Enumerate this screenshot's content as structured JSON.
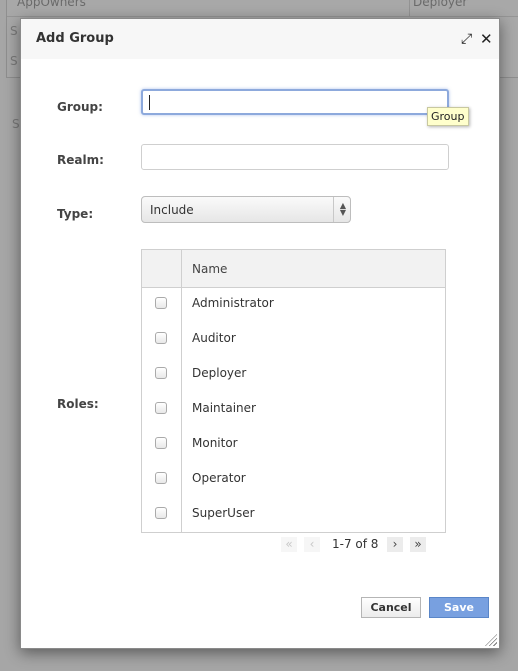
{
  "background": {
    "table_row": [
      "AppOwners",
      "Deployer"
    ],
    "stub_letters": [
      "S",
      "S",
      "S"
    ]
  },
  "dialog": {
    "title": "Add Group",
    "expand_icon": "expand-arrows-icon",
    "close_icon": "close-icon",
    "fields": {
      "group": {
        "label": "Group:",
        "value": "",
        "tooltip": "Group"
      },
      "realm": {
        "label": "Realm:",
        "value": ""
      },
      "type": {
        "label": "Type:",
        "selected": "Include"
      },
      "roles": {
        "label": "Roles:"
      }
    },
    "roles_table": {
      "header": "Name",
      "rows": [
        {
          "name": "Administrator",
          "checked": false
        },
        {
          "name": "Auditor",
          "checked": false
        },
        {
          "name": "Deployer",
          "checked": false
        },
        {
          "name": "Maintainer",
          "checked": false
        },
        {
          "name": "Monitor",
          "checked": false
        },
        {
          "name": "Operator",
          "checked": false
        },
        {
          "name": "SuperUser",
          "checked": false
        }
      ]
    },
    "pagination": {
      "first": "«",
      "prev": "‹",
      "status": "1-7 of 8",
      "next": "›",
      "last": "»"
    },
    "buttons": {
      "cancel": "Cancel",
      "save": "Save"
    },
    "colors": {
      "save_bg": "#78a0e0",
      "focus_border": "#8da9dc",
      "tooltip_bg": "#ffffcc"
    }
  }
}
